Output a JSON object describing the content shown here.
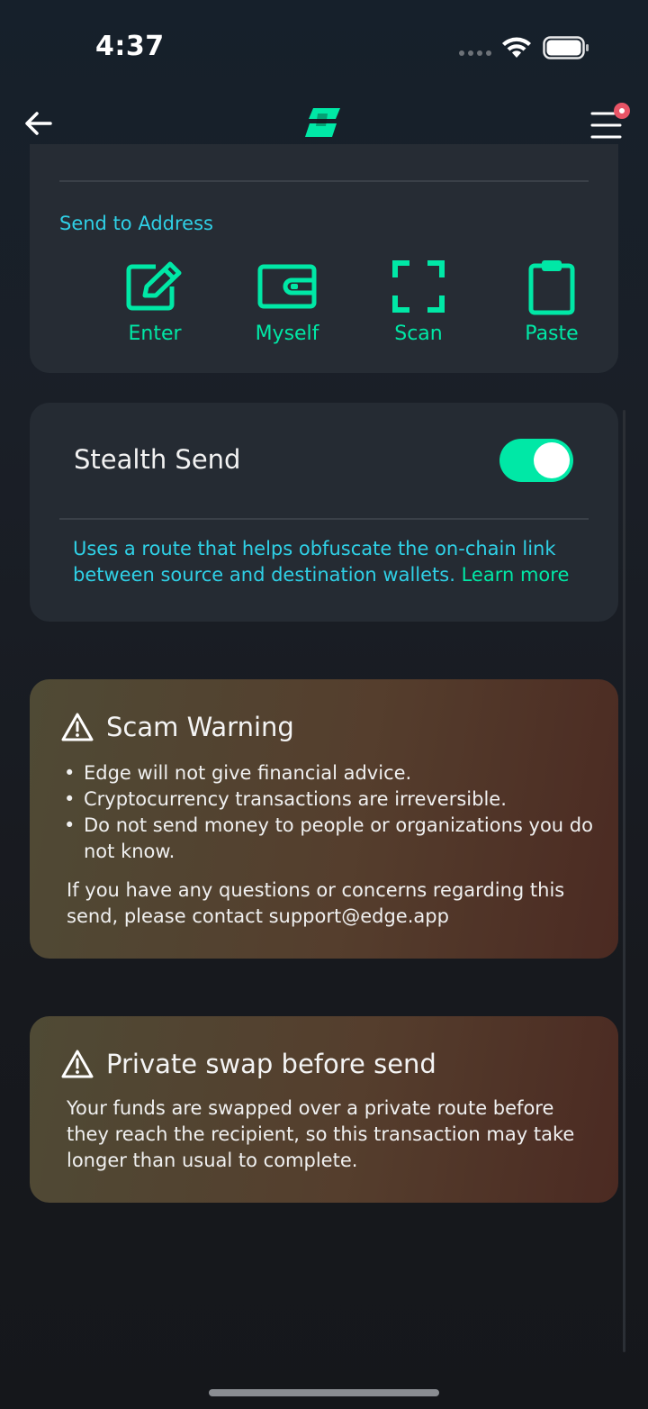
{
  "status_bar": {
    "time": "4:37"
  },
  "address_section": {
    "label": "Send to Address",
    "actions": [
      {
        "label": "Enter",
        "icon": "pencil-square-icon"
      },
      {
        "label": "Myself",
        "icon": "wallet-icon"
      },
      {
        "label": "Scan",
        "icon": "scan-frame-icon"
      },
      {
        "label": "Paste",
        "icon": "clipboard-icon"
      }
    ]
  },
  "stealth": {
    "title": "Stealth Send",
    "enabled": true,
    "description": "Uses a route that helps obfuscate the on-chain link between source and destination wallets.",
    "link_text": "Learn more"
  },
  "scam_warning": {
    "title": "Scam Warning",
    "bullets": [
      "Edge will not give financial advice.",
      "Cryptocurrency transactions are irreversible.",
      "Do not send money to people or organizations you do not know."
    ],
    "footer": "If you have any questions or concerns regarding this send, please contact support@edge.app"
  },
  "private_swap": {
    "title": "Private swap before send",
    "body": "Your funds are swapped over a private route before they reach the recipient, so this transaction may take longer than usual to complete."
  },
  "colors": {
    "accent_green": "#00e8a6",
    "accent_cyan": "#2fd0e6",
    "notification": "#e85466"
  }
}
